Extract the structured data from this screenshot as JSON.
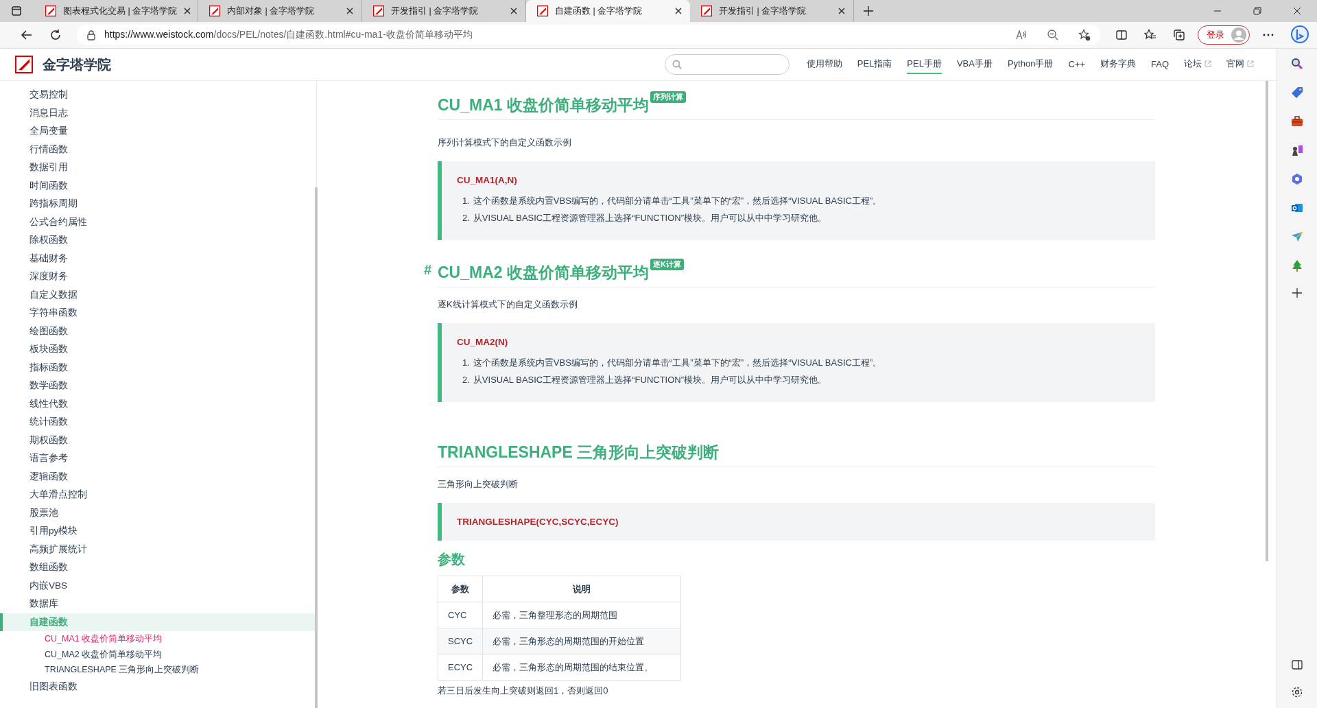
{
  "browser": {
    "tabs": [
      {
        "title": "图表程式化交易 | 金字塔学院",
        "selected": false
      },
      {
        "title": "内部对象 | 金字塔学院",
        "selected": false
      },
      {
        "title": "开发指引 | 金字塔学院",
        "selected": false
      },
      {
        "title": "自建函数 | 金字塔学院",
        "selected": true
      },
      {
        "title": "开发指引 | 金字塔学院",
        "selected": false
      }
    ],
    "url_host": "https://www.weistock.com",
    "url_path": "/docs/PEL/notes/自建函数.html#cu-ma1-收盘价简单移动平均",
    "login": "登录"
  },
  "site": {
    "logo_text": "金字塔学院",
    "nav": [
      {
        "label": "使用帮助",
        "selected": false,
        "external": false
      },
      {
        "label": "PEL指南",
        "selected": false,
        "external": false
      },
      {
        "label": "PEL手册",
        "selected": true,
        "external": false
      },
      {
        "label": "VBA手册",
        "selected": false,
        "external": false
      },
      {
        "label": "Python手册",
        "selected": false,
        "external": false
      },
      {
        "label": "C++",
        "selected": false,
        "external": false
      },
      {
        "label": "财务字典",
        "selected": false,
        "external": false
      },
      {
        "label": "FAQ",
        "selected": false,
        "external": false
      },
      {
        "label": "论坛",
        "selected": false,
        "external": true
      },
      {
        "label": "官网",
        "selected": false,
        "external": true
      }
    ]
  },
  "sidebar": {
    "items": [
      {
        "label": "交易控制",
        "selected": false
      },
      {
        "label": "消息日志",
        "selected": false
      },
      {
        "label": "全局变量",
        "selected": false
      },
      {
        "label": "行情函数",
        "selected": false
      },
      {
        "label": "数据引用",
        "selected": false
      },
      {
        "label": "时间函数",
        "selected": false
      },
      {
        "label": "跨指标周期",
        "selected": false
      },
      {
        "label": "公式合约属性",
        "selected": false
      },
      {
        "label": "除权函数",
        "selected": false
      },
      {
        "label": "基础财务",
        "selected": false
      },
      {
        "label": "深度财务",
        "selected": false
      },
      {
        "label": "自定义数据",
        "selected": false
      },
      {
        "label": "字符串函数",
        "selected": false
      },
      {
        "label": "绘图函数",
        "selected": false
      },
      {
        "label": "板块函数",
        "selected": false
      },
      {
        "label": "指标函数",
        "selected": false
      },
      {
        "label": "数学函数",
        "selected": false
      },
      {
        "label": "线性代数",
        "selected": false
      },
      {
        "label": "统计函数",
        "selected": false
      },
      {
        "label": "期权函数",
        "selected": false
      },
      {
        "label": "语言参考",
        "selected": false
      },
      {
        "label": "逻辑函数",
        "selected": false
      },
      {
        "label": "大单滑点控制",
        "selected": false
      },
      {
        "label": "股票池",
        "selected": false
      },
      {
        "label": "引用py模块",
        "selected": false
      },
      {
        "label": "高频扩展统计",
        "selected": false
      },
      {
        "label": "数组函数",
        "selected": false
      },
      {
        "label": "内嵌VBS",
        "selected": false
      },
      {
        "label": "数据库",
        "selected": false
      },
      {
        "label": "自建函数",
        "selected": true,
        "children": [
          {
            "label": "CU_MA1 收盘价简单移动平均",
            "selected": true
          },
          {
            "label": "CU_MA2 收盘价简单移动平均",
            "selected": false
          },
          {
            "label": "TRIANGLESHAPE 三角形向上突破判断",
            "selected": false
          }
        ]
      },
      {
        "label": "旧图表函数",
        "selected": false
      }
    ]
  },
  "sections": [
    {
      "title": "CU_MA1 收盘价简单移动平均",
      "badge": "序列计算",
      "description": "序列计算模式下的自定义函数示例",
      "signature": "CU_MA1(A,N)",
      "notes": [
        {
          "number": "1.",
          "text": "这个函数是系统内置VBS编写的，代码部分请单击“工具”菜单下的“宏”，然后选择“VISUAL BASIC工程”。"
        },
        {
          "number": "2.",
          "text": "从VISUAL BASIC工程资源管理器上选择“FUNCTION”模块。用户可以从中中学习研究他。"
        }
      ]
    },
    {
      "title": "CU_MA2 收盘价简单移动平均",
      "badge": "逐K计算",
      "anchor_mark": "#",
      "description": "逐K线计算模式下的自定义函数示例",
      "signature": "CU_MA2(N)",
      "notes": [
        {
          "number": "1.",
          "text": "这个函数是系统内置VBS编写的，代码部分请单击“工具”菜单下的“宏”，然后选择“VISUAL BASIC工程”。"
        },
        {
          "number": "2.",
          "text": "从VISUAL BASIC工程资源管理器上选择“FUNCTION”模块。用户可以从中中学习研究他。"
        }
      ]
    },
    {
      "title": "TRIANGLESHAPE 三角形向上突破判断",
      "description": "三角形向上突破判断",
      "signature": "TRIANGLESHAPE(CYC,SCYC,ECYC)",
      "params": {
        "heading": "参数",
        "columns": [
          "参数",
          "说明"
        ],
        "rows": [
          [
            "CYC",
            "必需，三角整理形态的周期范围"
          ],
          [
            "SCYC",
            "必需，三角形态的周期范围的开始位置"
          ],
          [
            "ECYC",
            "必需，三角形态的周期范围的结束位置。"
          ]
        ]
      },
      "returns": "若三日后发生向上突破则返回1，否则返回0"
    }
  ]
}
